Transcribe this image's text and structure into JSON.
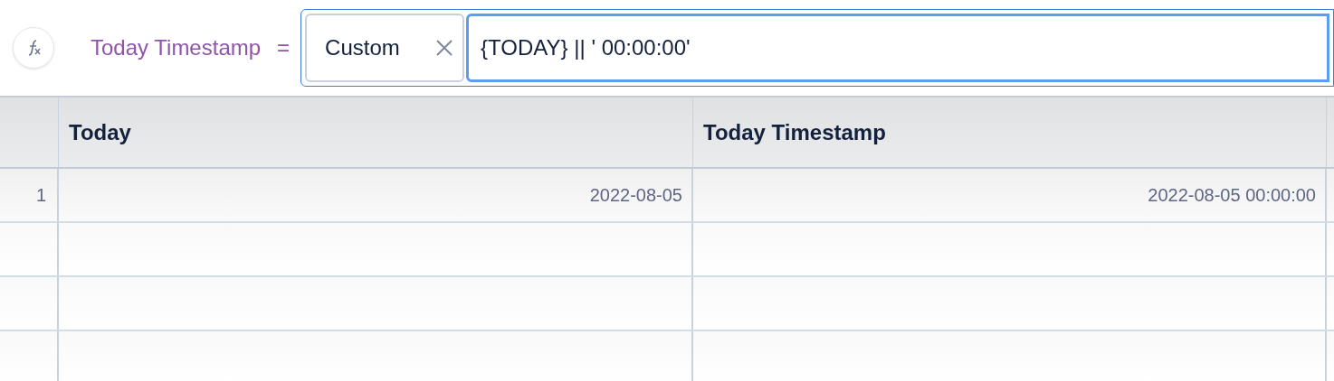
{
  "formula_bar": {
    "column_name": "Today Timestamp",
    "equals": "=",
    "mode_chip": {
      "label": "Custom"
    },
    "formula": "{TODAY} || ' 00:00:00'"
  },
  "table": {
    "columns": [
      "Today",
      "Today Timestamp"
    ],
    "rows": [
      {
        "number": "1",
        "cells": [
          "2022-08-05",
          "2022-08-05 00:00:00"
        ]
      }
    ]
  }
}
